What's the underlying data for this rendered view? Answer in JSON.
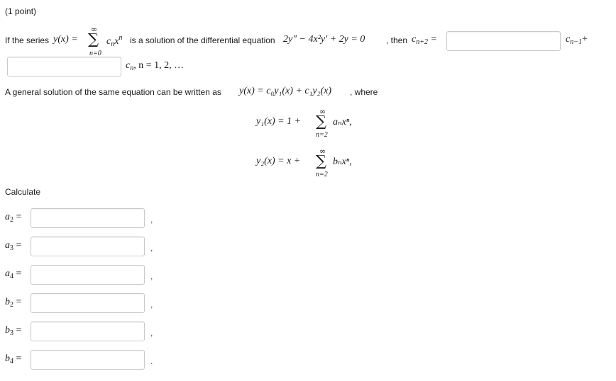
{
  "header": {
    "points": "(1 point)"
  },
  "q1": {
    "intro": "If the series",
    "series_lhs": "y(x)",
    "sum_upper": "∞",
    "sum_lower": "n=0",
    "term_c": "c",
    "term_sub": "n",
    "term_x": "x",
    "term_pow": "n",
    "mid": "is a solution of the differential equation",
    "eq": "2y″ − 4x²y′ + 2y = 0",
    "then": ", then",
    "lhs_c": "c",
    "lhs_sub": "n+2",
    "rhs1_c": "c",
    "rhs1_sub": "n−1",
    "plus": "+",
    "rhs2_c": "c",
    "rhs2_sub": "n",
    "range": ", n = 1, 2, …",
    "box1_value": "",
    "box2_value": ""
  },
  "q2": {
    "intro": "A general solution of the same equation can be written as",
    "gen": "y(x) = c₀y₁(x) + c₁y₂(x)",
    "where": ", where",
    "y1_lhs": "y₁(x) = 1 +",
    "y1_term": "aₙxⁿ,",
    "y2_lhs": "y₂(x) = x +",
    "y2_term": "bₙxⁿ,",
    "sum_upper": "∞",
    "sum_lower": "n=2"
  },
  "calculate": {
    "label": "Calculate",
    "items": [
      {
        "var": "a",
        "sub": "2",
        "value": "",
        "sep": ","
      },
      {
        "var": "a",
        "sub": "3",
        "value": "",
        "sep": ","
      },
      {
        "var": "a",
        "sub": "4",
        "value": "",
        "sep": ","
      },
      {
        "var": "b",
        "sub": "2",
        "value": "",
        "sep": ","
      },
      {
        "var": "b",
        "sub": "3",
        "value": "",
        "sep": ","
      },
      {
        "var": "b",
        "sub": "4",
        "value": "",
        "sep": "."
      }
    ]
  }
}
